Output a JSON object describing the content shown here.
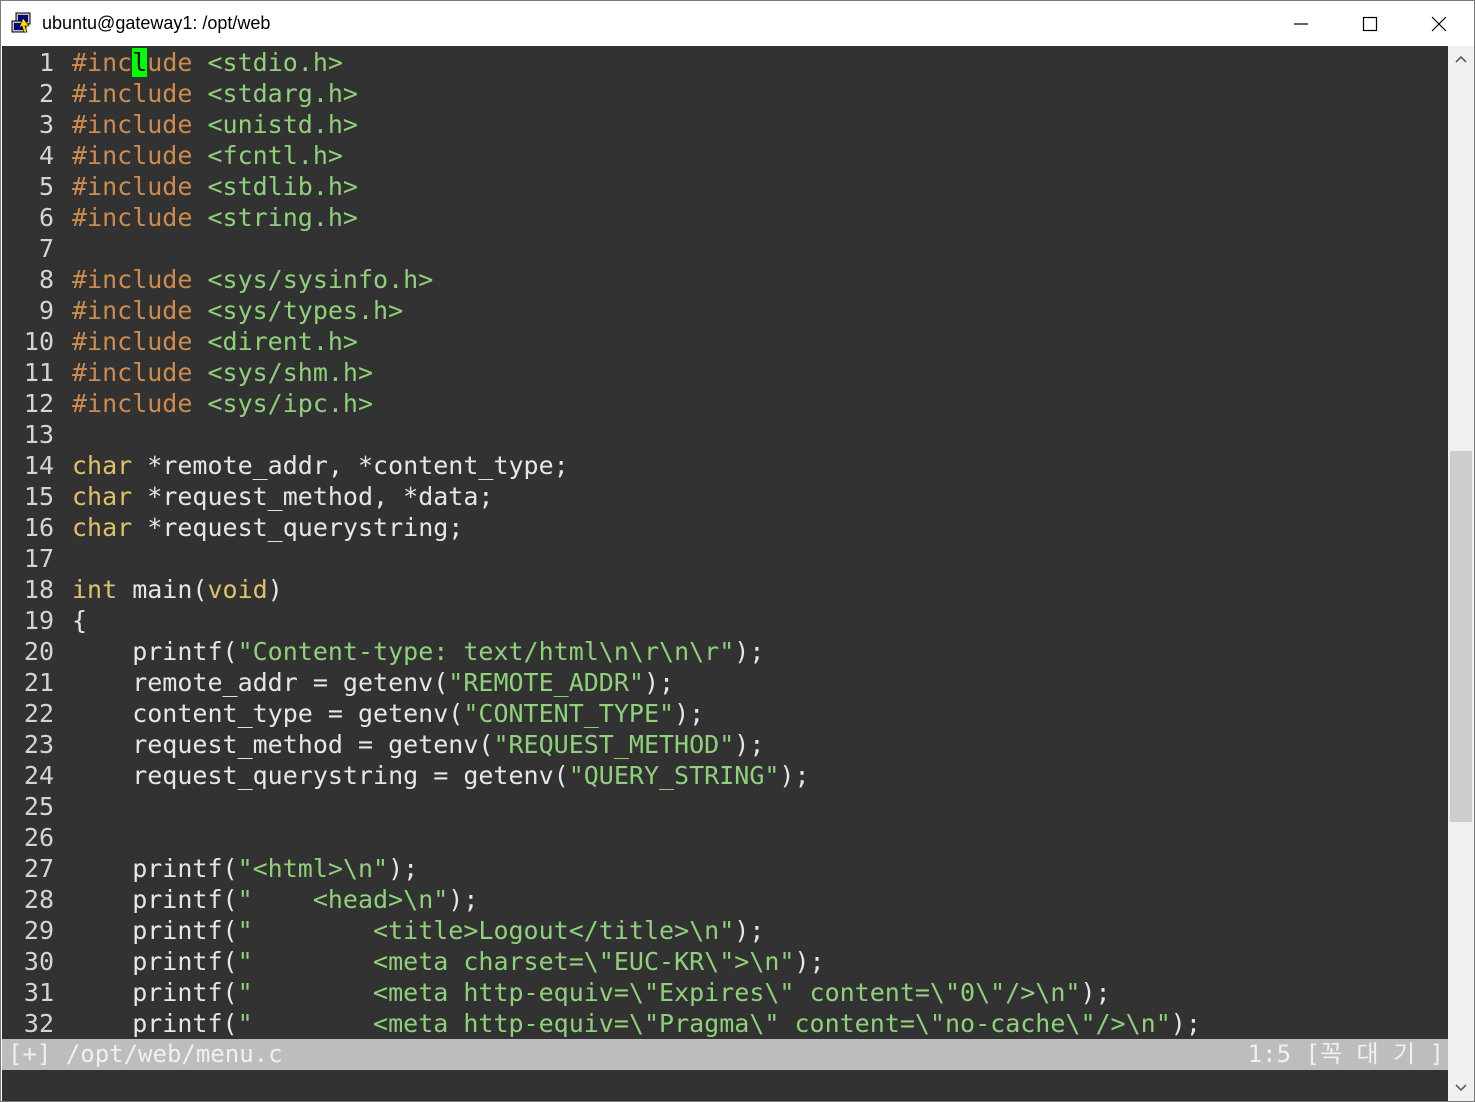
{
  "window": {
    "title": "ubuntu@gateway1: /opt/web",
    "icon": "putty-terminal-icon",
    "controls": [
      "minimize-icon",
      "maximize-icon",
      "close-icon"
    ]
  },
  "colors": {
    "background": "#323232",
    "line_number": "#d4d4d4",
    "preproc": "#cd8b4e",
    "include_path": "#8fd17a",
    "type": "#e0c06a",
    "text": "#e6e6e6",
    "string": "#8fd17a",
    "cursor": "#00ff00",
    "status_bg": "#bdbdbd"
  },
  "editor": {
    "cursor": {
      "line": 1,
      "col": 5
    },
    "lines": [
      {
        "n": "1",
        "tokens": [
          {
            "t": "#inc",
            "c": "preproc"
          },
          {
            "t": "l",
            "c": "cursor"
          },
          {
            "t": "ude",
            "c": "preproc"
          },
          {
            "t": " <stdio.h>",
            "c": "include_path"
          }
        ]
      },
      {
        "n": "2",
        "tokens": [
          {
            "t": "#include",
            "c": "preproc"
          },
          {
            "t": " <stdarg.h>",
            "c": "include_path"
          }
        ]
      },
      {
        "n": "3",
        "tokens": [
          {
            "t": "#include",
            "c": "preproc"
          },
          {
            "t": " <unistd.h>",
            "c": "include_path"
          }
        ]
      },
      {
        "n": "4",
        "tokens": [
          {
            "t": "#include",
            "c": "preproc"
          },
          {
            "t": " <fcntl.h>",
            "c": "include_path"
          }
        ]
      },
      {
        "n": "5",
        "tokens": [
          {
            "t": "#include",
            "c": "preproc"
          },
          {
            "t": " <stdlib.h>",
            "c": "include_path"
          }
        ]
      },
      {
        "n": "6",
        "tokens": [
          {
            "t": "#include",
            "c": "preproc"
          },
          {
            "t": " <string.h>",
            "c": "include_path"
          }
        ]
      },
      {
        "n": "7",
        "tokens": []
      },
      {
        "n": "8",
        "tokens": [
          {
            "t": "#include",
            "c": "preproc"
          },
          {
            "t": " <sys/sysinfo.h>",
            "c": "include_path"
          }
        ]
      },
      {
        "n": "9",
        "tokens": [
          {
            "t": "#include",
            "c": "preproc"
          },
          {
            "t": " <sys/types.h>",
            "c": "include_path"
          }
        ]
      },
      {
        "n": "10",
        "tokens": [
          {
            "t": "#include",
            "c": "preproc"
          },
          {
            "t": " <dirent.h>",
            "c": "include_path"
          }
        ]
      },
      {
        "n": "11",
        "tokens": [
          {
            "t": "#include",
            "c": "preproc"
          },
          {
            "t": " <sys/shm.h>",
            "c": "include_path"
          }
        ]
      },
      {
        "n": "12",
        "tokens": [
          {
            "t": "#include",
            "c": "preproc"
          },
          {
            "t": " <sys/ipc.h>",
            "c": "include_path"
          }
        ]
      },
      {
        "n": "13",
        "tokens": []
      },
      {
        "n": "14",
        "tokens": [
          {
            "t": "char",
            "c": "type"
          },
          {
            "t": " *remote_addr, *content_type;",
            "c": "text"
          }
        ]
      },
      {
        "n": "15",
        "tokens": [
          {
            "t": "char",
            "c": "type"
          },
          {
            "t": " *request_method, *data;",
            "c": "text"
          }
        ]
      },
      {
        "n": "16",
        "tokens": [
          {
            "t": "char",
            "c": "type"
          },
          {
            "t": " *request_querystring;",
            "c": "text"
          }
        ]
      },
      {
        "n": "17",
        "tokens": []
      },
      {
        "n": "18",
        "tokens": [
          {
            "t": "int",
            "c": "type"
          },
          {
            "t": " main(",
            "c": "text"
          },
          {
            "t": "void",
            "c": "type"
          },
          {
            "t": ")",
            "c": "text"
          }
        ]
      },
      {
        "n": "19",
        "tokens": [
          {
            "t": "{",
            "c": "text"
          }
        ]
      },
      {
        "n": "20",
        "tokens": [
          {
            "t": "    printf(",
            "c": "text"
          },
          {
            "t": "\"Content-type: text/html\\n\\r\\n\\r\"",
            "c": "string"
          },
          {
            "t": ");",
            "c": "text"
          }
        ]
      },
      {
        "n": "21",
        "tokens": [
          {
            "t": "    remote_addr = getenv(",
            "c": "text"
          },
          {
            "t": "\"REMOTE_ADDR\"",
            "c": "string"
          },
          {
            "t": ");",
            "c": "text"
          }
        ]
      },
      {
        "n": "22",
        "tokens": [
          {
            "t": "    content_type = getenv(",
            "c": "text"
          },
          {
            "t": "\"CONTENT_TYPE\"",
            "c": "string"
          },
          {
            "t": ");",
            "c": "text"
          }
        ]
      },
      {
        "n": "23",
        "tokens": [
          {
            "t": "    request_method = getenv(",
            "c": "text"
          },
          {
            "t": "\"REQUEST_METHOD\"",
            "c": "string"
          },
          {
            "t": ");",
            "c": "text"
          }
        ]
      },
      {
        "n": "24",
        "tokens": [
          {
            "t": "    request_querystring = getenv(",
            "c": "text"
          },
          {
            "t": "\"QUERY_STRING\"",
            "c": "string"
          },
          {
            "t": ");",
            "c": "text"
          }
        ]
      },
      {
        "n": "25",
        "tokens": []
      },
      {
        "n": "26",
        "tokens": []
      },
      {
        "n": "27",
        "tokens": [
          {
            "t": "    printf(",
            "c": "text"
          },
          {
            "t": "\"<html>\\n\"",
            "c": "string"
          },
          {
            "t": ");",
            "c": "text"
          }
        ]
      },
      {
        "n": "28",
        "tokens": [
          {
            "t": "    printf(",
            "c": "text"
          },
          {
            "t": "\"    <head>\\n\"",
            "c": "string"
          },
          {
            "t": ");",
            "c": "text"
          }
        ]
      },
      {
        "n": "29",
        "tokens": [
          {
            "t": "    printf(",
            "c": "text"
          },
          {
            "t": "\"        <title>Logout</title>\\n\"",
            "c": "string"
          },
          {
            "t": ");",
            "c": "text"
          }
        ]
      },
      {
        "n": "30",
        "tokens": [
          {
            "t": "    printf(",
            "c": "text"
          },
          {
            "t": "\"        <meta charset=\\\"EUC-KR\\\">\\n\"",
            "c": "string"
          },
          {
            "t": ");",
            "c": "text"
          }
        ]
      },
      {
        "n": "31",
        "tokens": [
          {
            "t": "    printf(",
            "c": "text"
          },
          {
            "t": "\"        <meta http-equiv=\\\"Expires\\\" content=\\\"0\\\"/>\\n\"",
            "c": "string"
          },
          {
            "t": ");",
            "c": "text"
          }
        ]
      },
      {
        "n": "32",
        "tokens": [
          {
            "t": "    printf(",
            "c": "text"
          },
          {
            "t": "\"        <meta http-equiv=\\\"Pragma\\\" content=\\\"no-cache\\\"/>\\n\"",
            "c": "string"
          },
          {
            "t": ");",
            "c": "text"
          }
        ]
      }
    ]
  },
  "statusline": {
    "left": "[+] /opt/web/menu.c",
    "right": "1:5 [꼭 대 기 ]"
  },
  "scrollbar": {
    "up_icon": "scroll-up-arrow-icon",
    "down_icon": "scroll-down-arrow-icon",
    "position_fraction": 0.6
  }
}
